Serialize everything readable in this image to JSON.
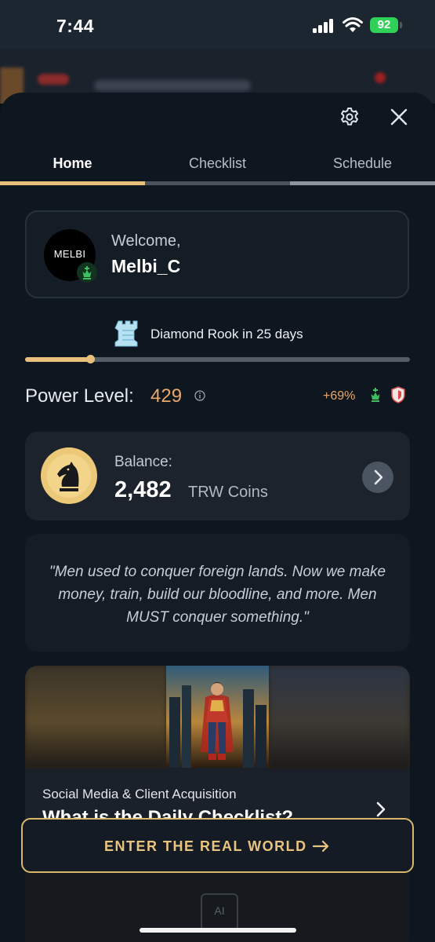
{
  "status_bar": {
    "time": "7:44",
    "battery": "92"
  },
  "header": {
    "icons": [
      "gear-icon",
      "close-icon"
    ]
  },
  "tabs": [
    {
      "label": "Home",
      "active": true
    },
    {
      "label": "Checklist",
      "active": false
    },
    {
      "label": "Schedule",
      "active": false
    }
  ],
  "welcome": {
    "avatar_text": "MELBI",
    "label": "Welcome,",
    "username": "Melbi_C"
  },
  "rank": {
    "text": "Diamond Rook in 25 days",
    "progress": 0.17
  },
  "power": {
    "label": "Power Level:",
    "value": "429",
    "growth": "+69%"
  },
  "balance": {
    "label": "Balance:",
    "amount": "2,482",
    "unit": "TRW Coins"
  },
  "quote": {
    "text": "\"Men used to conquer foreign lands. Now we make money, train, build our bloodline, and more. Men MUST conquer something.\""
  },
  "lesson": {
    "category": "Social Media & Client Acquisition",
    "title": "What is the Daily Checklist?"
  },
  "cta": {
    "label": "ENTER THE REAL WORLD"
  },
  "colors": {
    "accent": "#e8c07c",
    "power_value": "#e9a869",
    "badge_green": "#3fbf5f",
    "background": "#0e1620"
  }
}
